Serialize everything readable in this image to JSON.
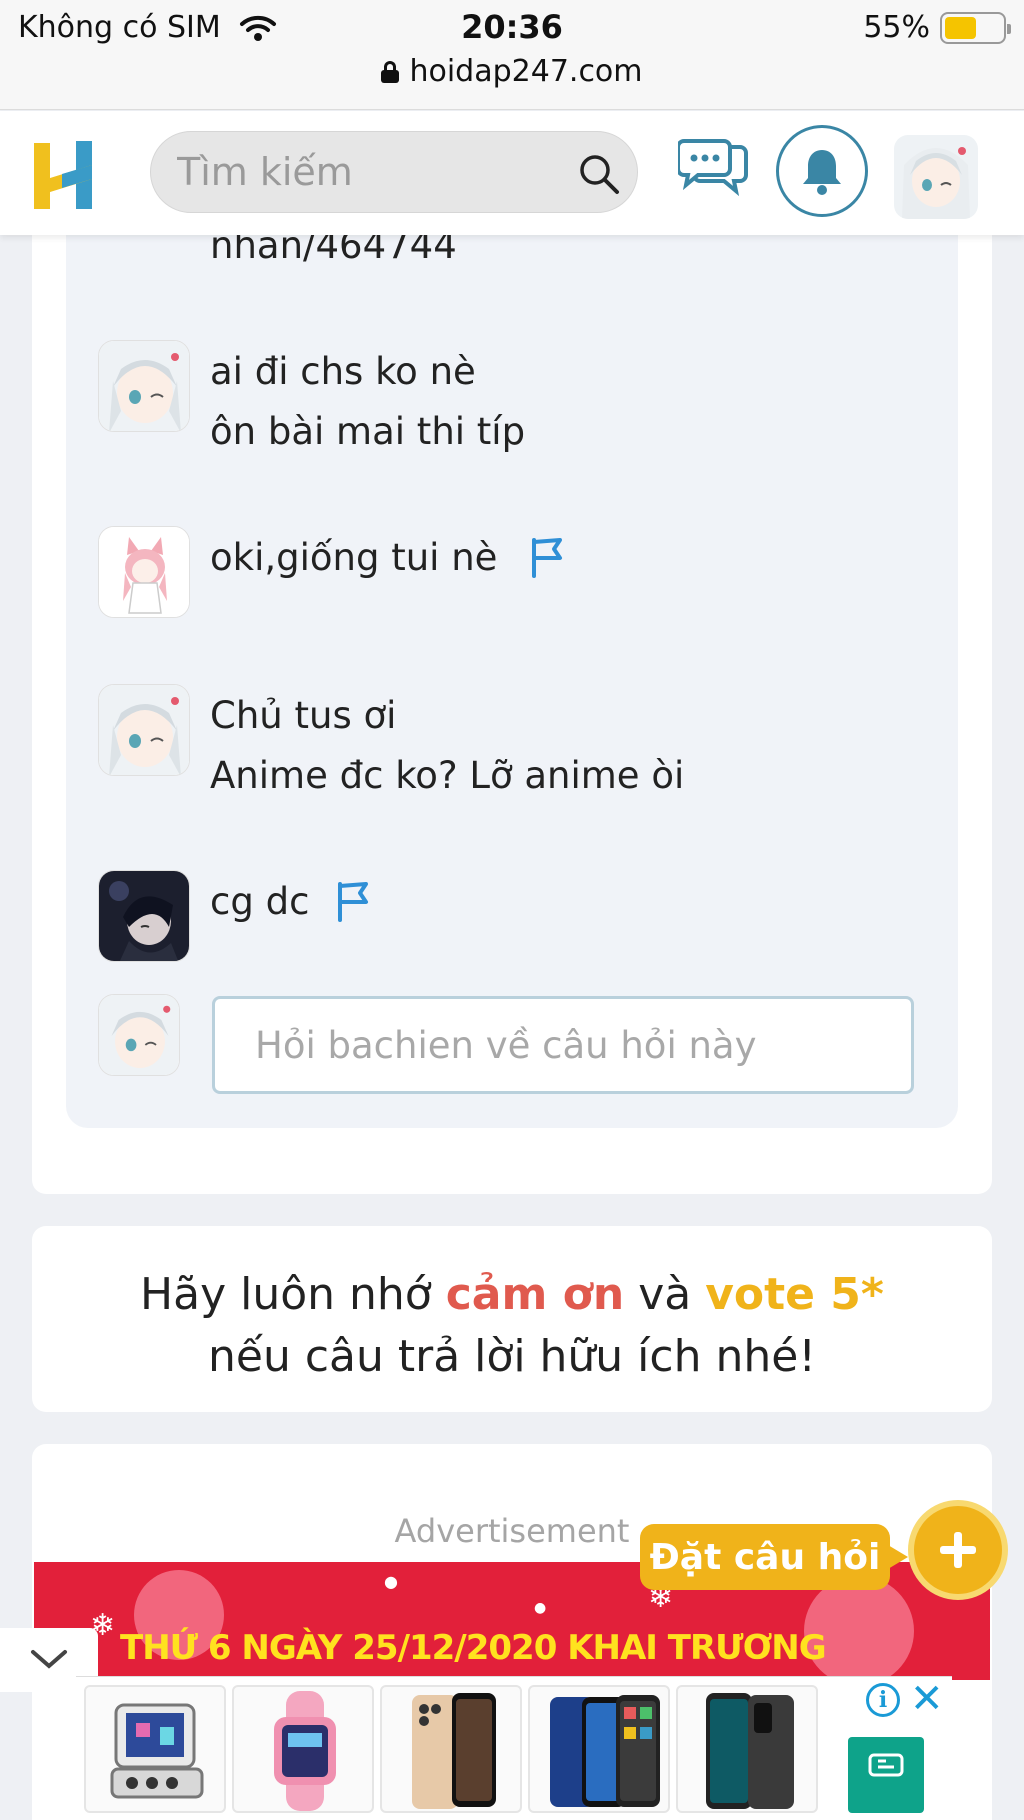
{
  "status_bar": {
    "carrier": "Không có SIM",
    "time": "20:36",
    "battery_percent": "55%",
    "battery_level": 0.55,
    "url": "hoidap247.com"
  },
  "header": {
    "search_placeholder": "Tìm kiếm",
    "logo_icon": "logo-h",
    "accent_color": "#3a86a5",
    "logo_yellow": "#f0c01e",
    "logo_blue": "#3a9bc7"
  },
  "comments": {
    "truncated_text": "nhan/464744",
    "items": [
      {
        "lines": [
          "ai đi chs ko nè",
          "ôn bài mai thi típ"
        ],
        "has_flag": false
      },
      {
        "lines": [
          "oki,giống tui nè"
        ],
        "has_flag": true
      },
      {
        "lines": [
          "Chủ tus ơi",
          "Anime đc ko? Lỡ anime òi"
        ],
        "has_flag": false
      },
      {
        "lines": [
          "cg dc"
        ],
        "has_flag": true
      }
    ],
    "reply_placeholder": "Hỏi bachien về câu hỏi này"
  },
  "reminder": {
    "prefix": "Hãy luôn nhớ ",
    "thanks": "cảm ơn",
    "middle": " và ",
    "vote": "vote 5*",
    "line2": "nếu câu trả lời hữu ích nhé!"
  },
  "ad": {
    "label": "Advertisement",
    "banner_text": "THỨ 6 NGÀY 25/12/2020 KHAI TRƯƠNG",
    "banner_color": "#e2203a",
    "info_icon": "i",
    "close_icon": "✕"
  },
  "ask_button": {
    "label": "Đặt câu hỏi",
    "icon": "+",
    "color": "#f0b31a"
  }
}
